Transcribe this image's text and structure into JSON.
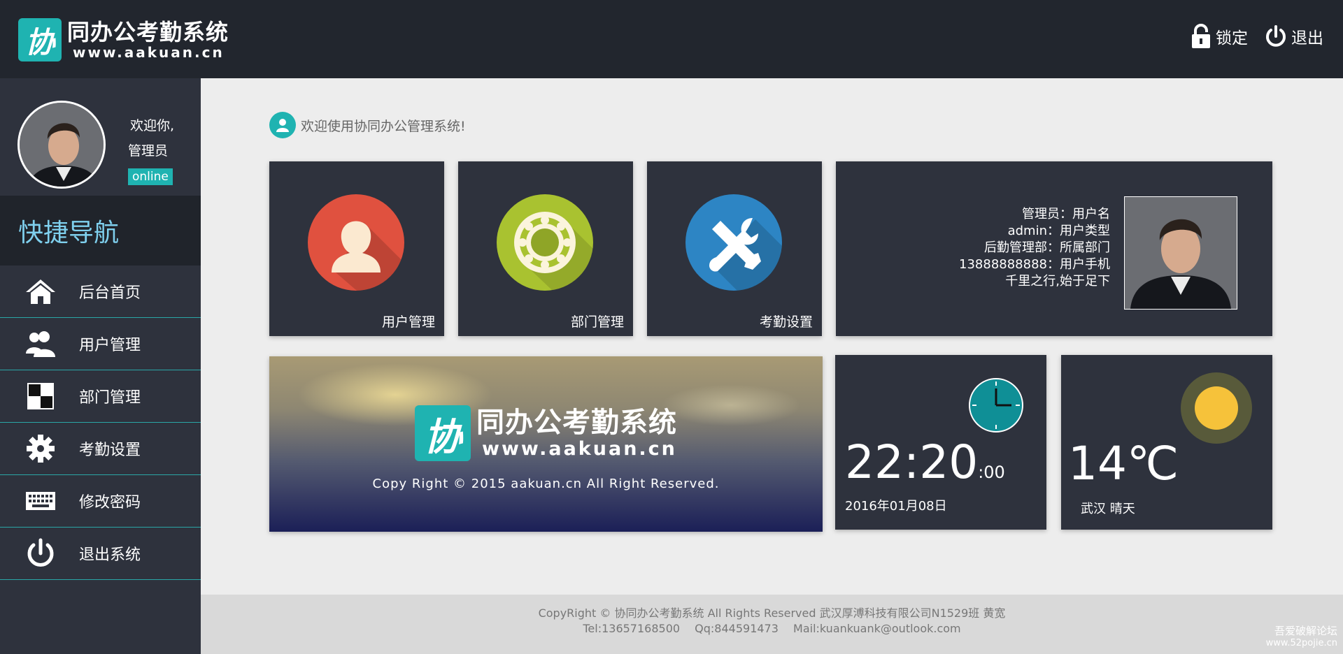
{
  "header": {
    "logo_mark": "协",
    "logo_title": "同办公考勤系统",
    "logo_url": "www.aakuan.cn",
    "lock_label": "锁定",
    "logout_label": "退出"
  },
  "sidebar": {
    "greeting": "欢迎你,",
    "username": "管理员",
    "status": "online",
    "nav_title": "快捷导航",
    "items": [
      {
        "label": "后台首页",
        "icon": "home-icon"
      },
      {
        "label": "用户管理",
        "icon": "users-icon"
      },
      {
        "label": "部门管理",
        "icon": "checker-icon"
      },
      {
        "label": "考勤设置",
        "icon": "gear-icon"
      },
      {
        "label": "修改密码",
        "icon": "keyboard-icon"
      },
      {
        "label": "退出系统",
        "icon": "power-icon"
      }
    ]
  },
  "main": {
    "welcome_text": "欢迎使用协同办公管理系统!",
    "tiles": [
      {
        "label": "用户管理",
        "icon": "user-bust-icon",
        "color": "#e0513f"
      },
      {
        "label": "部门管理",
        "icon": "bearing-icon",
        "color": "#a9c230"
      },
      {
        "label": "考勤设置",
        "icon": "tools-icon",
        "color": "#2d85c4"
      }
    ],
    "profile_info": {
      "line1": "管理员：用户名",
      "line2": "admin：用户类型",
      "line3": "后勤管理部：所属部门",
      "line4": "13888888888：用户手机",
      "line5": "千里之行,始于足下"
    },
    "banner": {
      "logo_mark": "协",
      "logo_title": "同办公考勤系统",
      "logo_url": "www.aakuan.cn",
      "copyright": "Copy Right © 2015 aakuan.cn All Right Reserved."
    },
    "clock": {
      "time": "22:20",
      "seconds": ":00",
      "date": "2016年01月08日"
    },
    "weather": {
      "temperature": "14℃",
      "location": "武汉 晴天"
    }
  },
  "footer": {
    "line1": "CopyRight © 协同办公考勤系统 All Rights Reserved 武汉厚溥科技有限公司N1529班 黄宽",
    "tel": "Tel:13657168500",
    "qq": "Qq:844591473",
    "mail": "Mail:kuankuank@outlook.com"
  },
  "watermark": {
    "line1": "吾爱破解论坛",
    "line2": "www.52pojie.cn"
  },
  "colors": {
    "accent": "#1fb3b1",
    "header_bg": "#22262e",
    "sidebar_bg": "#2e323d",
    "tile_bg": "#2e323d"
  }
}
